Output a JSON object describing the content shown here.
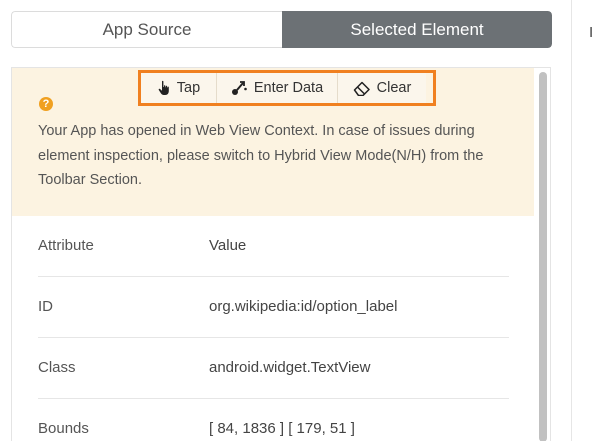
{
  "tabs": [
    {
      "label": "App Source",
      "active": false
    },
    {
      "label": "Selected Element",
      "active": true
    }
  ],
  "actions": {
    "tap": "Tap",
    "enter_data": "Enter Data",
    "clear": "Clear"
  },
  "notice": {
    "text": "Your App has opened in Web View Context. In case of issues during element inspection, please switch to Hybrid View Mode(N/H) from the Toolbar Section."
  },
  "attributes": {
    "header": {
      "attribute": "Attribute",
      "value": "Value"
    },
    "rows": [
      {
        "attribute": "ID",
        "value": "org.wikipedia:id/option_label"
      },
      {
        "attribute": "Class",
        "value": "android.widget.TextView"
      },
      {
        "attribute": "Bounds",
        "value": "[ 84, 1836 ] [ 179, 51 ]"
      }
    ]
  },
  "right_panel": {
    "text": "I"
  },
  "colors": {
    "accent_orange": "#f08020",
    "notice_bg": "#fcf3e1",
    "active_tab": "#6c7175",
    "help_icon": "#f0a020"
  }
}
